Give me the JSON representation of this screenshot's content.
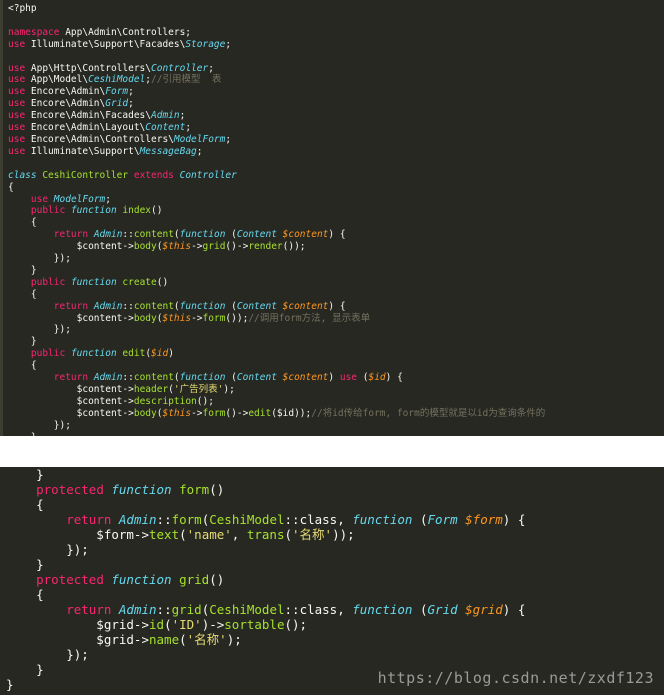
{
  "panels": {
    "top": {
      "lines": [
        [
          [
            "t-plain",
            "<?php"
          ]
        ],
        [
          [
            "t-plain",
            ""
          ]
        ],
        [
          [
            "t-kw",
            "namespace "
          ],
          [
            "t-plain",
            "App\\Admin\\Controllers;"
          ]
        ],
        [
          [
            "t-kw",
            "use "
          ],
          [
            "t-plain",
            "Illuminate\\Support\\Facades\\"
          ],
          [
            "t-type",
            "Storage"
          ],
          [
            "t-plain",
            ";"
          ]
        ],
        [
          [
            "t-plain",
            ""
          ]
        ],
        [
          [
            "t-kw",
            "use "
          ],
          [
            "t-plain",
            "App\\Http\\Controllers\\"
          ],
          [
            "t-type",
            "Controller"
          ],
          [
            "t-plain",
            ";"
          ]
        ],
        [
          [
            "t-kw",
            "use "
          ],
          [
            "t-plain",
            "App\\Model\\"
          ],
          [
            "t-type",
            "CeshiModel"
          ],
          [
            "t-plain",
            ";"
          ],
          [
            "t-cmt",
            "//引用模型  表"
          ]
        ],
        [
          [
            "t-kw",
            "use "
          ],
          [
            "t-plain",
            "Encore\\Admin\\"
          ],
          [
            "t-type",
            "Form"
          ],
          [
            "t-plain",
            ";"
          ]
        ],
        [
          [
            "t-kw",
            "use "
          ],
          [
            "t-plain",
            "Encore\\Admin\\"
          ],
          [
            "t-type",
            "Grid"
          ],
          [
            "t-plain",
            ";"
          ]
        ],
        [
          [
            "t-kw",
            "use "
          ],
          [
            "t-plain",
            "Encore\\Admin\\Facades\\"
          ],
          [
            "t-type",
            "Admin"
          ],
          [
            "t-plain",
            ";"
          ]
        ],
        [
          [
            "t-kw",
            "use "
          ],
          [
            "t-plain",
            "Encore\\Admin\\Layout\\"
          ],
          [
            "t-type",
            "Content"
          ],
          [
            "t-plain",
            ";"
          ]
        ],
        [
          [
            "t-kw",
            "use "
          ],
          [
            "t-plain",
            "Encore\\Admin\\Controllers\\"
          ],
          [
            "t-type",
            "ModelForm"
          ],
          [
            "t-plain",
            ";"
          ]
        ],
        [
          [
            "t-kw",
            "use "
          ],
          [
            "t-plain",
            "Illuminate\\Support\\"
          ],
          [
            "t-type",
            "MessageBag"
          ],
          [
            "t-plain",
            ";"
          ]
        ],
        [
          [
            "t-plain",
            ""
          ]
        ],
        [
          [
            "t-fn",
            "class "
          ],
          [
            "t-cls",
            "CeshiController "
          ],
          [
            "t-kw",
            "extends "
          ],
          [
            "t-type",
            "Controller"
          ]
        ],
        [
          [
            "t-plain",
            "{"
          ]
        ],
        [
          [
            "t-plain",
            "    "
          ],
          [
            "t-kw",
            "use "
          ],
          [
            "t-type",
            "ModelForm"
          ],
          [
            "t-plain",
            ";"
          ]
        ],
        [
          [
            "t-plain",
            "    "
          ],
          [
            "t-kw",
            "public "
          ],
          [
            "t-fn",
            "function "
          ],
          [
            "t-call",
            "index"
          ],
          [
            "t-plain",
            "()"
          ]
        ],
        [
          [
            "t-plain",
            "    {"
          ]
        ],
        [
          [
            "t-plain",
            "        "
          ],
          [
            "t-kw",
            "return "
          ],
          [
            "t-type",
            "Admin"
          ],
          [
            "t-plain",
            "::"
          ],
          [
            "t-call",
            "content"
          ],
          [
            "t-plain",
            "("
          ],
          [
            "t-fn",
            "function "
          ],
          [
            "t-plain",
            "("
          ],
          [
            "t-type",
            "Content "
          ],
          [
            "t-var",
            "$content"
          ],
          [
            "t-plain",
            ") {"
          ]
        ],
        [
          [
            "t-plain",
            "            $content->"
          ],
          [
            "t-call",
            "body"
          ],
          [
            "t-plain",
            "("
          ],
          [
            "t-this",
            "$this"
          ],
          [
            "t-plain",
            "->"
          ],
          [
            "t-call",
            "grid"
          ],
          [
            "t-plain",
            "()->"
          ],
          [
            "t-call",
            "render"
          ],
          [
            "t-plain",
            "());"
          ]
        ],
        [
          [
            "t-plain",
            "        });"
          ]
        ],
        [
          [
            "t-plain",
            "    }"
          ]
        ],
        [
          [
            "t-plain",
            "    "
          ],
          [
            "t-kw",
            "public "
          ],
          [
            "t-fn",
            "function "
          ],
          [
            "t-call",
            "create"
          ],
          [
            "t-plain",
            "()"
          ]
        ],
        [
          [
            "t-plain",
            "    {"
          ]
        ],
        [
          [
            "t-plain",
            "        "
          ],
          [
            "t-kw",
            "return "
          ],
          [
            "t-type",
            "Admin"
          ],
          [
            "t-plain",
            "::"
          ],
          [
            "t-call",
            "content"
          ],
          [
            "t-plain",
            "("
          ],
          [
            "t-fn",
            "function "
          ],
          [
            "t-plain",
            "("
          ],
          [
            "t-type",
            "Content "
          ],
          [
            "t-var",
            "$content"
          ],
          [
            "t-plain",
            ") {"
          ]
        ],
        [
          [
            "t-plain",
            "            $content->"
          ],
          [
            "t-call",
            "body"
          ],
          [
            "t-plain",
            "("
          ],
          [
            "t-this",
            "$this"
          ],
          [
            "t-plain",
            "->"
          ],
          [
            "t-call",
            "form"
          ],
          [
            "t-plain",
            "());"
          ],
          [
            "t-cmt",
            "//调用form方法, 显示表单"
          ]
        ],
        [
          [
            "t-plain",
            "        });"
          ]
        ],
        [
          [
            "t-plain",
            "    }"
          ]
        ],
        [
          [
            "t-plain",
            "    "
          ],
          [
            "t-kw",
            "public "
          ],
          [
            "t-fn",
            "function "
          ],
          [
            "t-call",
            "edit"
          ],
          [
            "t-plain",
            "("
          ],
          [
            "t-var",
            "$id"
          ],
          [
            "t-plain",
            ")"
          ]
        ],
        [
          [
            "t-plain",
            "    {"
          ]
        ],
        [
          [
            "t-plain",
            "        "
          ],
          [
            "t-kw",
            "return "
          ],
          [
            "t-type",
            "Admin"
          ],
          [
            "t-plain",
            "::"
          ],
          [
            "t-call",
            "content"
          ],
          [
            "t-plain",
            "("
          ],
          [
            "t-fn",
            "function "
          ],
          [
            "t-plain",
            "("
          ],
          [
            "t-type",
            "Content "
          ],
          [
            "t-var",
            "$content"
          ],
          [
            "t-plain",
            ") "
          ],
          [
            "t-kw",
            "use "
          ],
          [
            "t-plain",
            "("
          ],
          [
            "t-var",
            "$id"
          ],
          [
            "t-plain",
            ") {"
          ]
        ],
        [
          [
            "t-plain",
            "            $content->"
          ],
          [
            "t-call",
            "header"
          ],
          [
            "t-plain",
            "("
          ],
          [
            "t-str",
            "'广告列表'"
          ],
          [
            "t-plain",
            ");"
          ]
        ],
        [
          [
            "t-plain",
            "            $content->"
          ],
          [
            "t-call",
            "description"
          ],
          [
            "t-plain",
            "();"
          ]
        ],
        [
          [
            "t-plain",
            "            $content->"
          ],
          [
            "t-call",
            "body"
          ],
          [
            "t-plain",
            "("
          ],
          [
            "t-this",
            "$this"
          ],
          [
            "t-plain",
            "->"
          ],
          [
            "t-call",
            "form"
          ],
          [
            "t-plain",
            "()->"
          ],
          [
            "t-call",
            "edit"
          ],
          [
            "t-plain",
            "($id));"
          ],
          [
            "t-cmt",
            "//将id传给form, form的模型就是以id为查询条件的"
          ]
        ],
        [
          [
            "t-plain",
            "        });"
          ]
        ],
        [
          [
            "t-plain",
            "    }"
          ]
        ]
      ]
    },
    "bottom": {
      "lines": [
        [
          [
            "t-plain",
            "    }"
          ]
        ],
        [
          [
            "t-plain",
            "    "
          ],
          [
            "t-kw",
            "protected "
          ],
          [
            "t-fn",
            "function "
          ],
          [
            "t-call",
            "form"
          ],
          [
            "t-plain",
            "()"
          ]
        ],
        [
          [
            "t-plain",
            "    {"
          ]
        ],
        [
          [
            "t-plain",
            "        "
          ],
          [
            "t-kw",
            "return "
          ],
          [
            "t-type",
            "Admin"
          ],
          [
            "t-plain",
            "::"
          ],
          [
            "t-call",
            "form"
          ],
          [
            "t-plain",
            "("
          ],
          [
            "t-call",
            "CeshiModel"
          ],
          [
            "t-plain",
            "::class, "
          ],
          [
            "t-fn",
            "function "
          ],
          [
            "t-plain",
            "("
          ],
          [
            "t-type",
            "Form "
          ],
          [
            "t-var",
            "$form"
          ],
          [
            "t-plain",
            ") {"
          ]
        ],
        [
          [
            "t-plain",
            "            $form->"
          ],
          [
            "t-call",
            "text"
          ],
          [
            "t-plain",
            "("
          ],
          [
            "t-str",
            "'name'"
          ],
          [
            "t-plain",
            ", "
          ],
          [
            "t-call",
            "trans"
          ],
          [
            "t-plain",
            "("
          ],
          [
            "t-str",
            "'名称'"
          ],
          [
            "t-plain",
            "));"
          ]
        ],
        [
          [
            "t-plain",
            "        });"
          ]
        ],
        [
          [
            "t-plain",
            "    }"
          ]
        ],
        [
          [
            "t-plain",
            "    "
          ],
          [
            "t-kw",
            "protected "
          ],
          [
            "t-fn",
            "function "
          ],
          [
            "t-call",
            "grid"
          ],
          [
            "t-plain",
            "()"
          ]
        ],
        [
          [
            "t-plain",
            "    {"
          ]
        ],
        [
          [
            "t-plain",
            "        "
          ],
          [
            "t-kw",
            "return "
          ],
          [
            "t-type",
            "Admin"
          ],
          [
            "t-plain",
            "::"
          ],
          [
            "t-call",
            "grid"
          ],
          [
            "t-plain",
            "("
          ],
          [
            "t-call",
            "CeshiModel"
          ],
          [
            "t-plain",
            "::class, "
          ],
          [
            "t-fn",
            "function "
          ],
          [
            "t-plain",
            "("
          ],
          [
            "t-type",
            "Grid "
          ],
          [
            "t-var",
            "$grid"
          ],
          [
            "t-plain",
            ") {"
          ]
        ],
        [
          [
            "t-plain",
            "            $grid->"
          ],
          [
            "t-call",
            "id"
          ],
          [
            "t-plain",
            "("
          ],
          [
            "t-str",
            "'ID'"
          ],
          [
            "t-plain",
            ")->"
          ],
          [
            "t-call",
            "sortable"
          ],
          [
            "t-plain",
            "();"
          ]
        ],
        [
          [
            "t-plain",
            "            $grid->"
          ],
          [
            "t-call",
            "name"
          ],
          [
            "t-plain",
            "("
          ],
          [
            "t-str",
            "'名称'"
          ],
          [
            "t-plain",
            ");"
          ]
        ],
        [
          [
            "t-plain",
            "        });"
          ]
        ],
        [
          [
            "t-plain",
            "    }"
          ]
        ],
        [
          [
            "t-plain",
            "}"
          ]
        ]
      ]
    }
  },
  "watermark": "https://blog.csdn.net/zxdf123"
}
